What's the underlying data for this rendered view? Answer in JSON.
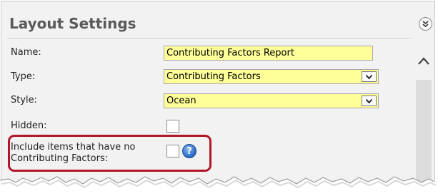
{
  "panel": {
    "title": "Layout Settings",
    "collapse_icon": "double-chevron-down-icon"
  },
  "fields": {
    "name_label": "Name:",
    "name_value": "Contributing Factors Report",
    "type_label": "Type:",
    "type_value": "Contributing Factors",
    "style_label": "Style:",
    "style_value": "Ocean",
    "hidden_label": "Hidden:",
    "hidden_checked": false,
    "include_label_line1": "Include items that have no",
    "include_label_line2": "Contributing Factors:",
    "include_checked": false
  },
  "colors": {
    "field_bg": "#ffff99",
    "highlight_border": "#b0172a",
    "help_icon": "#3a78d0"
  },
  "icons": {
    "help": "question-mark-icon",
    "dropdown": "chevron-down-icon",
    "scroll_up": "chevron-up-icon"
  }
}
